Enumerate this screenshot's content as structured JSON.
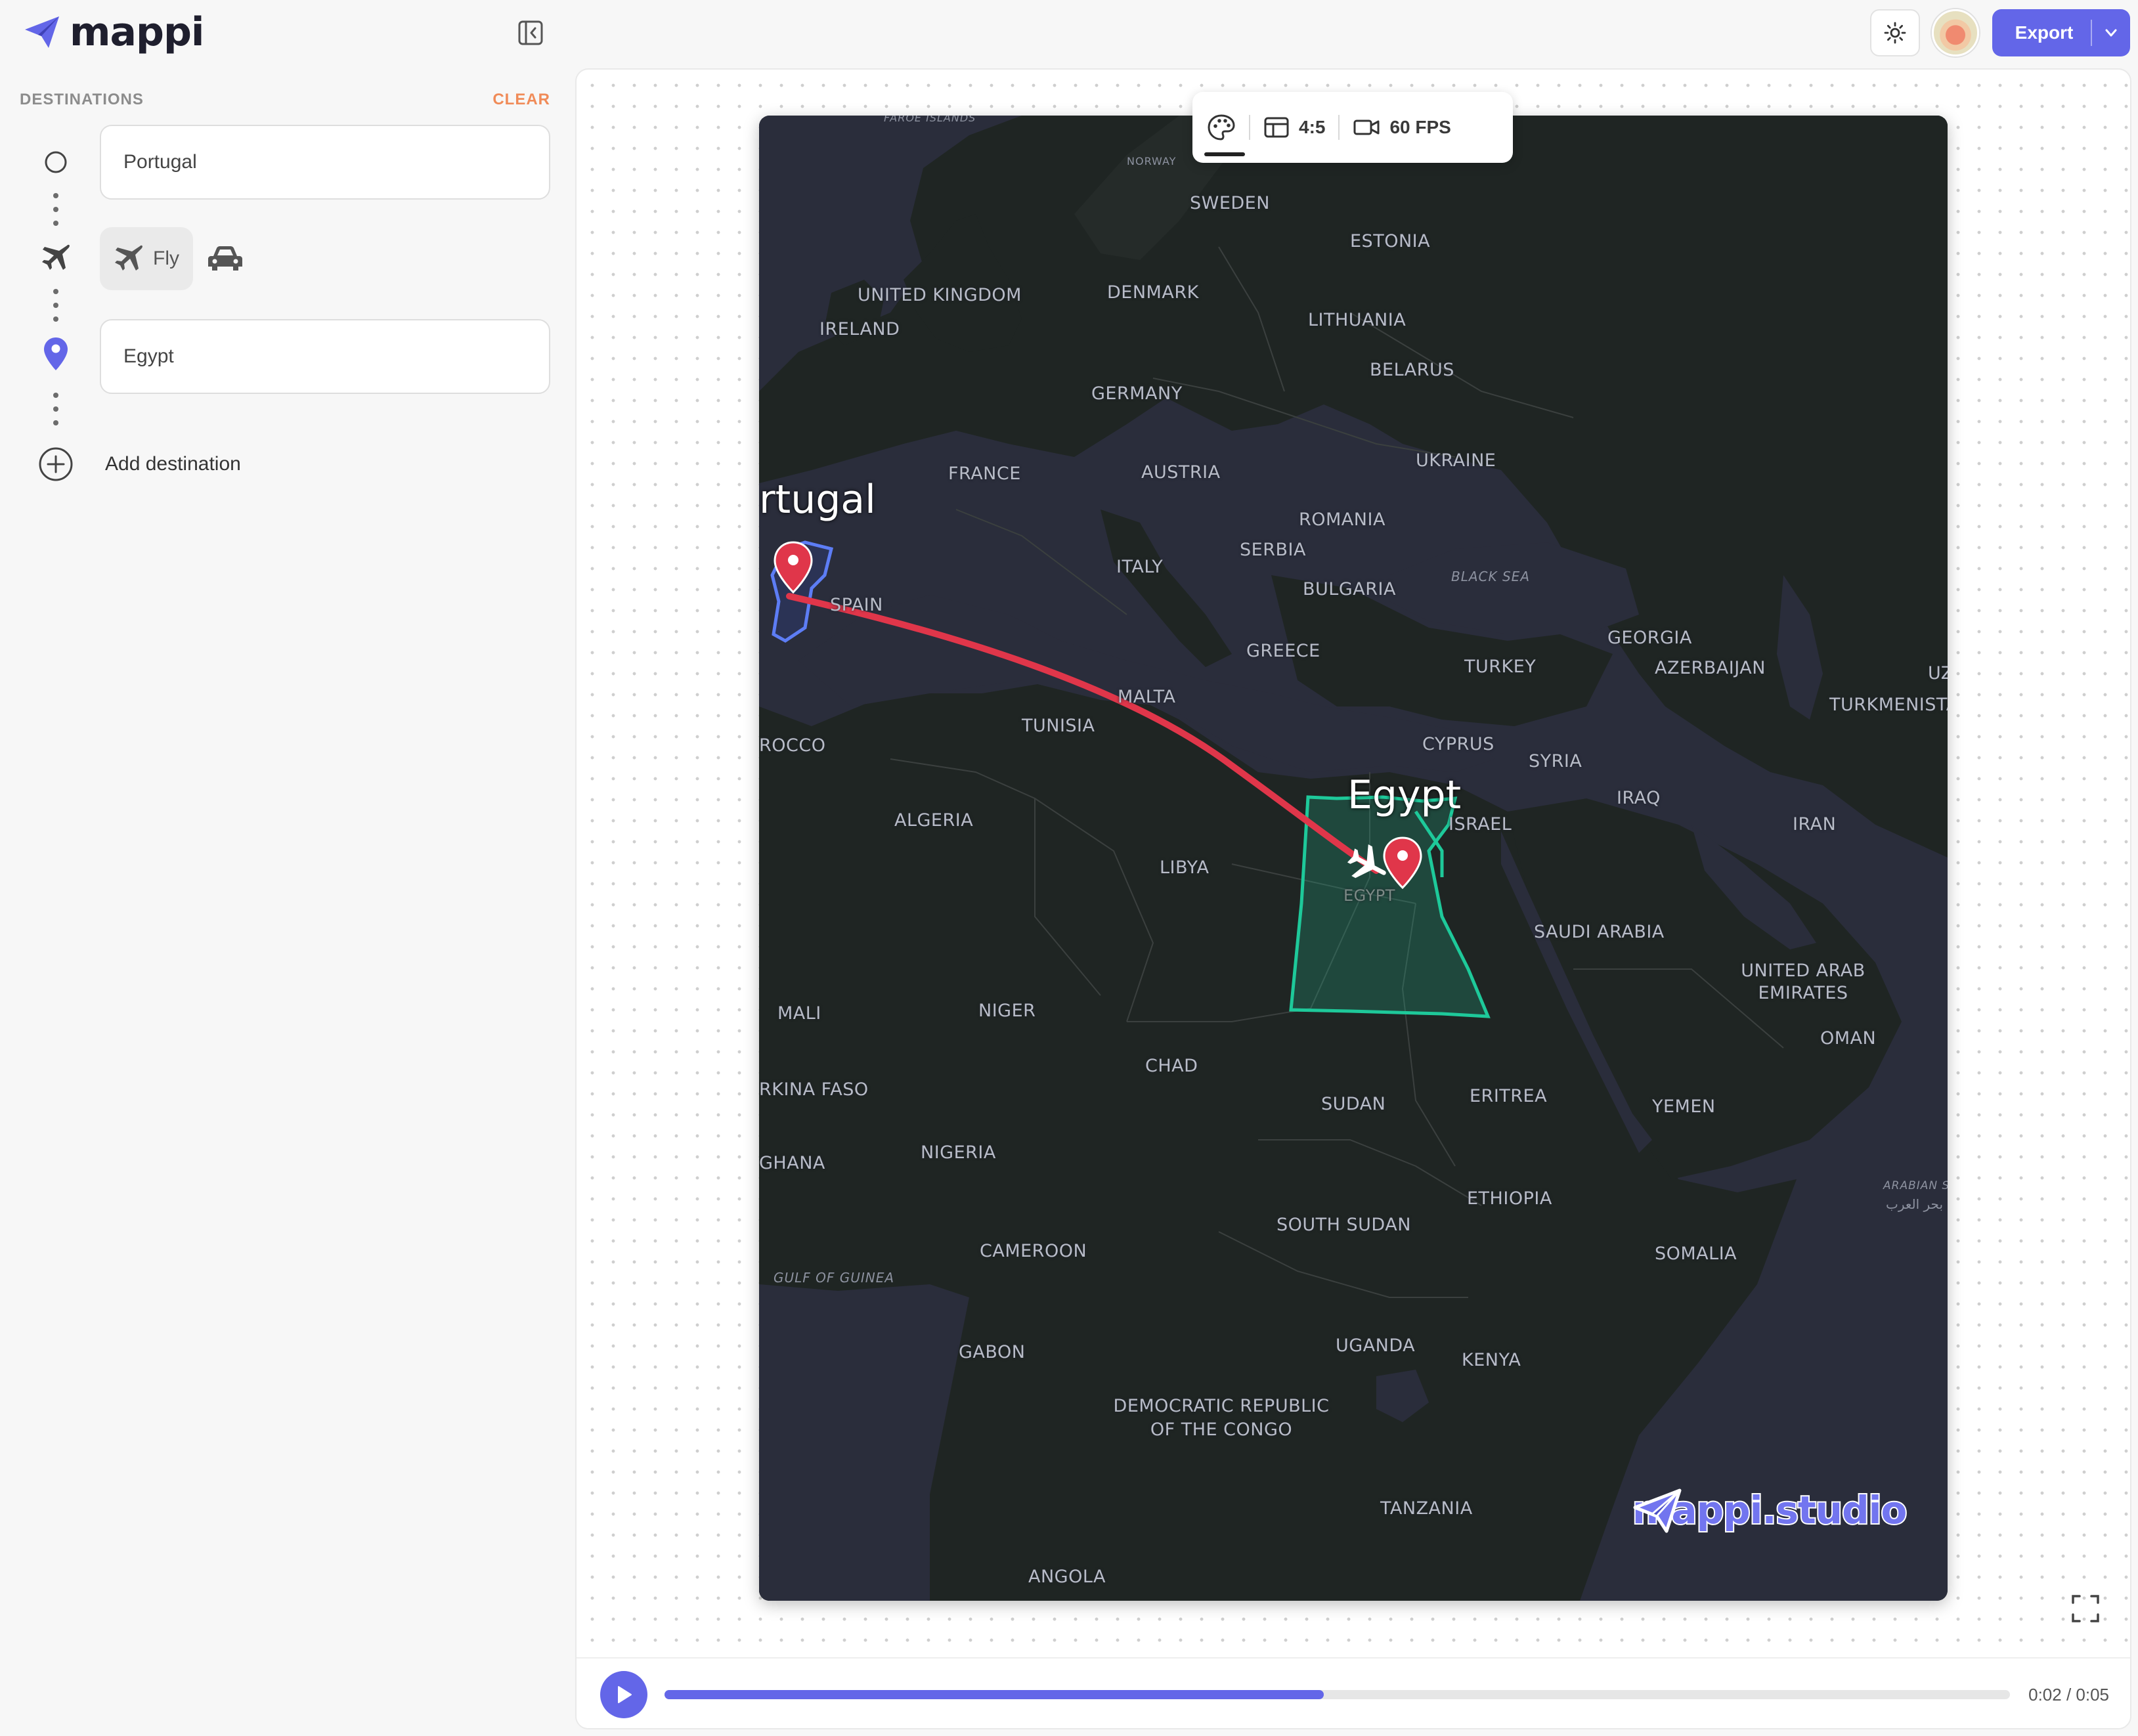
{
  "app": {
    "name": "mappi"
  },
  "header": {
    "export_label": "Export"
  },
  "sidebar": {
    "title": "DESTINATIONS",
    "clear_label": "CLEAR",
    "origin": {
      "value": "Portugal"
    },
    "mode": {
      "selected_label": "Fly",
      "options": [
        "fly",
        "car"
      ]
    },
    "destination": {
      "value": "Egypt"
    },
    "add_label": "Add destination"
  },
  "toolbar": {
    "aspect_ratio": "4:5",
    "fps": "60 FPS"
  },
  "map": {
    "origin_label": "rtugal",
    "destination_label": "Egypt",
    "watermark": "mappi.studio",
    "colors": {
      "route": "#e0364a",
      "origin_outline": "#5d7df5",
      "destination_outline": "#1ec99a",
      "water": "#2a2d3b",
      "land": "#1f2422"
    },
    "labels": [
      "FAROE ISLANDS",
      "NORWAY",
      "SWEDEN",
      "ESTONIA",
      "UNITED KINGDOM",
      "DENMARK",
      "IRELAND",
      "LITHUANIA",
      "BELARUS",
      "GERMANY",
      "UKRAINE",
      "FRANCE",
      "AUSTRIA",
      "ROMANIA",
      "SERBIA",
      "ITALY",
      "BULGARIA",
      "GEORGIA",
      "SPAIN",
      "GREECE",
      "TURKEY",
      "AZERBAIJAN",
      "UZ",
      "MALTA",
      "TURKMENISTA",
      "TUNISIA",
      "ROCCO",
      "CYPRUS",
      "SYRIA",
      "IRAQ",
      "ISRAEL",
      "IRAN",
      "ALGERIA",
      "LIBYA",
      "EGYPT",
      "SAUDI ARABIA",
      "UNITED ARAB EMIRATES",
      "MALI",
      "NIGER",
      "OMAN",
      "CHAD",
      "RKINA FASO",
      "SUDAN",
      "ERITREA",
      "YEMEN",
      "NIGERIA",
      "GHANA",
      "ETHIOPIA",
      "SOUTH SUDAN",
      "CAMEROON",
      "SOMALIA",
      "GABON",
      "UGANDA",
      "KENYA",
      "DEMOCRATIC REPUBLIC OF THE CONGO",
      "TANZANIA",
      "ANGOLA"
    ],
    "seas": [
      "BLACK SEA",
      "GULF OF GUINEA",
      "ARABIAN S"
    ],
    "seas_extra": "بحر العرب"
  },
  "player": {
    "progress": 0.49,
    "current_time": "0:02",
    "total_time": "0:05",
    "time_sep": " / "
  }
}
